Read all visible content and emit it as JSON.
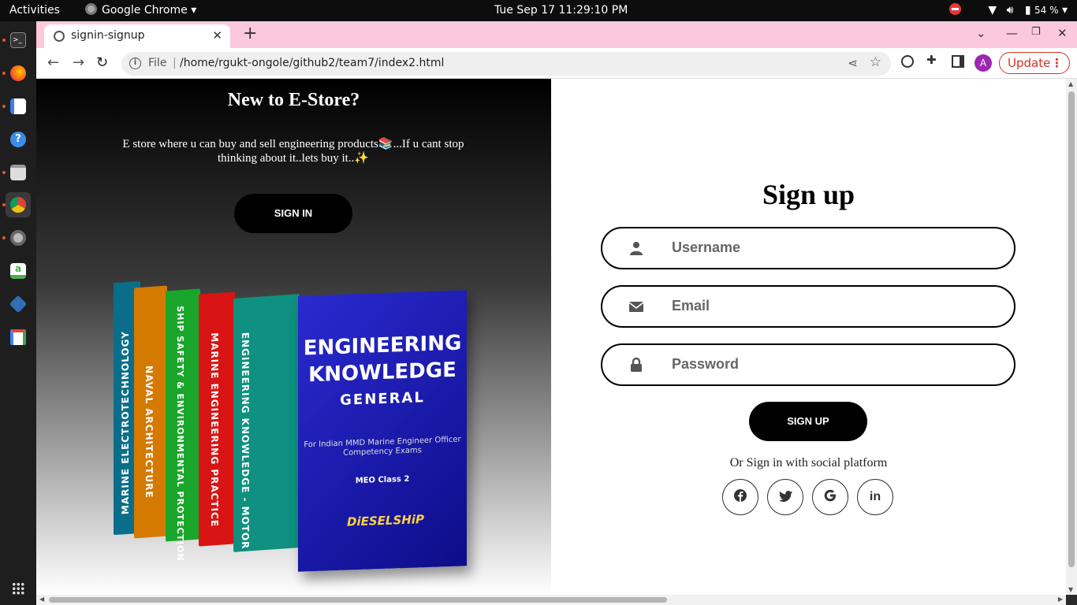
{
  "topbar": {
    "activities": "Activities",
    "app_name": "Google Chrome",
    "clock": "Tue Sep 17  11:29:10 PM",
    "battery": "54 %"
  },
  "browser": {
    "tab_title": "signin-signup",
    "scheme_label": "File",
    "url": "/home/rgukt-ongole/github2/team7/index2.html",
    "profile_initial": "A",
    "update_label": "Update"
  },
  "left_panel": {
    "title": "New to E-Store?",
    "text": "E store where u can buy and sell engineering products📚...If u cant stop thinking about it..lets buy it..✨",
    "signin_label": "SIGN IN",
    "books": {
      "spine_1": "MARINE ELECTROTECHNOLOGY",
      "spine_2": "NAVAL ARCHITECTURE",
      "spine_3": "SHIP SAFETY & ENVIRONMENTAL PROTECTION",
      "spine_4": "MARINE ENGINEERING PRACTICE",
      "spine_5": "ENGINEERING KNOWLEDGE - MOTOR",
      "cover_title": "ENGINEERING KNOWLEDGE",
      "cover_subtitle": "GENERAL",
      "cover_text": "For Indian MMD Marine Engineer Officer Competency Exams",
      "cover_class": "MEO Class 2",
      "cover_brand": "DiESELSHiP"
    }
  },
  "signup": {
    "title": "Sign up",
    "username_placeholder": "Username",
    "email_placeholder": "Email",
    "password_placeholder": "Password",
    "button_label": "SIGN UP",
    "social_text": "Or Sign in with social platform",
    "social": [
      "facebook",
      "twitter",
      "google",
      "linkedin"
    ],
    "linkedin_label": "in"
  },
  "colors": {
    "tabstrip": "#fcc8dc",
    "update_red": "#d93025",
    "profile_purple": "#9c27b0",
    "button_black": "#000000"
  }
}
